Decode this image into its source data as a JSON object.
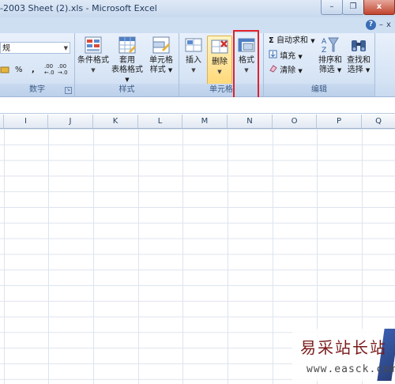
{
  "window": {
    "title": "-2003 Sheet (2).xls - Microsoft Excel",
    "minimize_glyph": "–",
    "restore_glyph": "❐",
    "close_glyph": "x"
  },
  "ribbon_top": {
    "help_glyph": "?",
    "mdi_minimize": "–",
    "mdi_restore": "❐",
    "mdi_close": "x"
  },
  "number_group": {
    "format_value": "规",
    "label": "数字",
    "percent": "%",
    "comma": ",",
    "inc_decimal": ".00 ←.0",
    "dec_decimal": ".00 →.0"
  },
  "styles_group": {
    "label": "样式",
    "conditional_format": "条件格式",
    "table_format_1": "套用",
    "table_format_2": "表格格式",
    "cell_styles_1": "单元格",
    "cell_styles_2": "样式"
  },
  "cells_group": {
    "label": "单元格",
    "insert": "插入",
    "delete": "删除",
    "format": "格式"
  },
  "editing_group": {
    "label": "编辑",
    "autosum": "自动求和",
    "fill": "填充",
    "clear": "清除",
    "sort_filter_1": "排序和",
    "sort_filter_2": "筛选",
    "find_select_1": "查找和",
    "find_select_2": "选择"
  },
  "columns": [
    "I",
    "J",
    "K",
    "L",
    "M",
    "N",
    "O",
    "P",
    "Q"
  ],
  "watermark": {
    "chinese": "易采站长站",
    "url": "www.easck.com"
  },
  "colors": {
    "ribbon_bg": "#d6e4f5",
    "highlight": "#ffd97a",
    "annotation_red": "#e0212b"
  }
}
